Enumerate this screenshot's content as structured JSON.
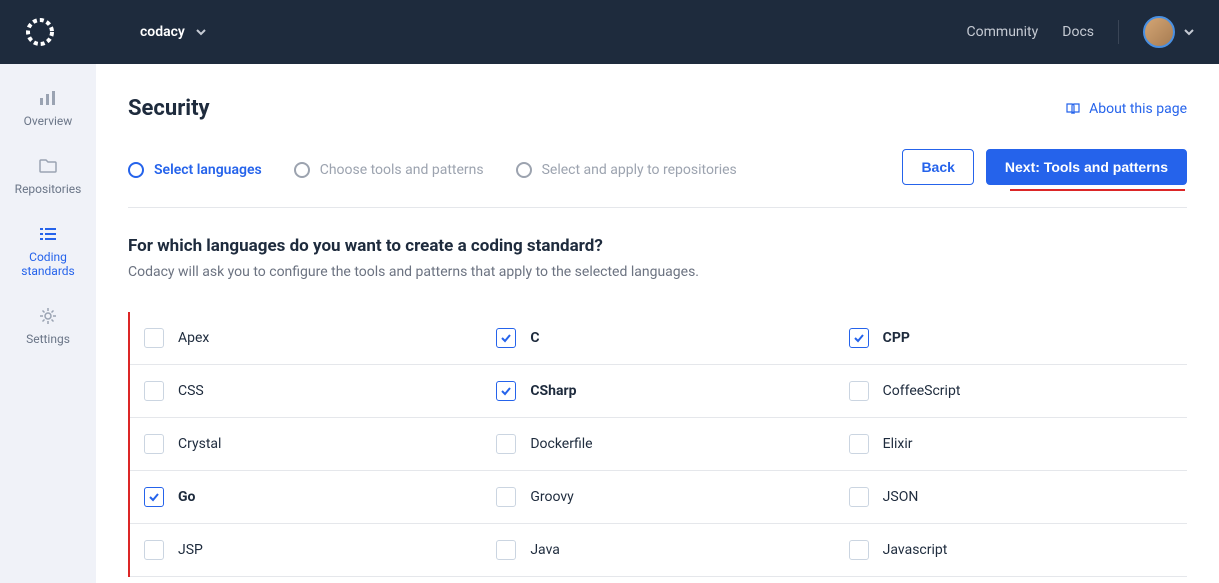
{
  "header": {
    "org_name": "codacy",
    "links": {
      "community": "Community",
      "docs": "Docs"
    }
  },
  "sidebar": {
    "items": [
      {
        "label": "Overview"
      },
      {
        "label": "Repositories"
      },
      {
        "label": "Coding standards"
      },
      {
        "label": "Settings"
      }
    ]
  },
  "page": {
    "title": "Security",
    "about_link": "About this page"
  },
  "wizard": {
    "steps": [
      {
        "label": "Select languages"
      },
      {
        "label": "Choose tools and patterns"
      },
      {
        "label": "Select and apply to repositories"
      }
    ],
    "back_label": "Back",
    "next_label": "Next: Tools and patterns"
  },
  "section": {
    "title": "For which languages do you want to create a coding standard?",
    "subtitle": "Codacy will ask you to configure the tools and patterns that apply to the selected languages."
  },
  "languages": {
    "col1": [
      {
        "name": "Apex",
        "checked": false
      },
      {
        "name": "CSS",
        "checked": false
      },
      {
        "name": "Crystal",
        "checked": false
      },
      {
        "name": "Go",
        "checked": true
      },
      {
        "name": "JSP",
        "checked": false
      }
    ],
    "col2": [
      {
        "name": "C",
        "checked": true
      },
      {
        "name": "CSharp",
        "checked": true
      },
      {
        "name": "Dockerfile",
        "checked": false
      },
      {
        "name": "Groovy",
        "checked": false
      },
      {
        "name": "Java",
        "checked": false
      }
    ],
    "col3": [
      {
        "name": "CPP",
        "checked": true
      },
      {
        "name": "CoffeeScript",
        "checked": false
      },
      {
        "name": "Elixir",
        "checked": false
      },
      {
        "name": "JSON",
        "checked": false
      },
      {
        "name": "Javascript",
        "checked": false
      }
    ]
  }
}
